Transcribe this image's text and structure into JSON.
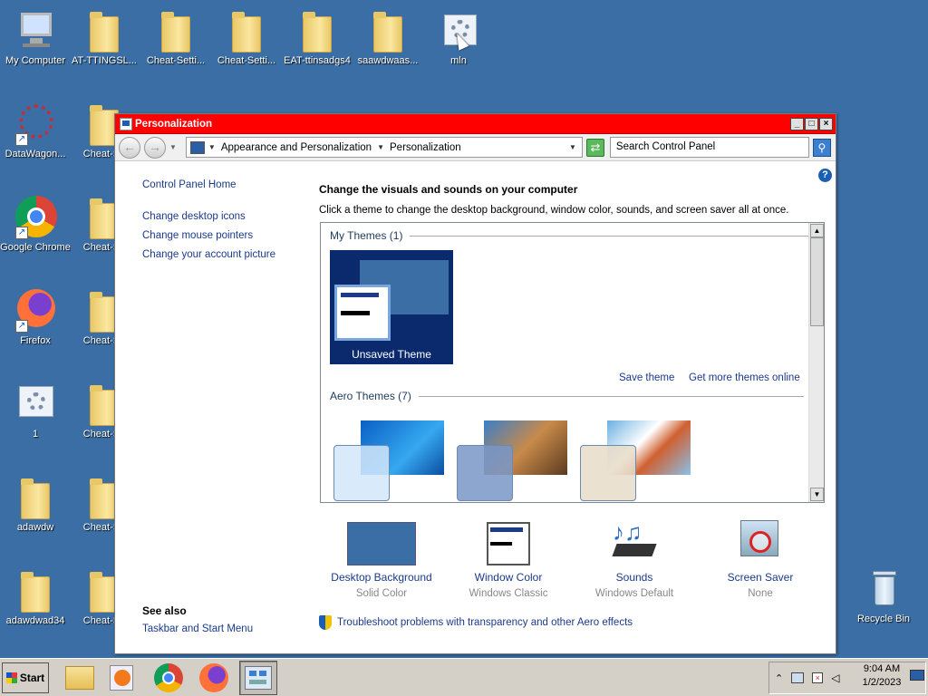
{
  "desktop": {
    "icons": [
      {
        "label": "My Computer",
        "icon": "computer-icon"
      },
      {
        "label": "AT-TTINGSL...",
        "icon": "folder-icon"
      },
      {
        "label": "Cheat-Setti...",
        "icon": "folder-icon"
      },
      {
        "label": "Cheat-Setti...",
        "icon": "folder-icon"
      },
      {
        "label": "EAT-ttinsadgs4",
        "icon": "folder-icon"
      },
      {
        "label": "saawdwaas...",
        "icon": "folder-icon"
      },
      {
        "label": "mln",
        "icon": "settings-icon"
      },
      {
        "label": "DataWagon...",
        "icon": "datawagon-icon"
      },
      {
        "label": "Cheat-Se",
        "icon": "folder-icon"
      },
      {
        "label": "Google Chrome",
        "icon": "chrome-icon"
      },
      {
        "label": "Cheat-Se",
        "icon": "folder-icon"
      },
      {
        "label": "Firefox",
        "icon": "firefox-icon"
      },
      {
        "label": "Cheat-Se",
        "icon": "folder-icon"
      },
      {
        "label": "1",
        "icon": "settings-icon"
      },
      {
        "label": "Cheat-Se",
        "icon": "folder-icon"
      },
      {
        "label": "adawdw",
        "icon": "folder-icon"
      },
      {
        "label": "Cheat-Se",
        "icon": "folder-icon"
      },
      {
        "label": "adawdwad34",
        "icon": "folder-icon"
      },
      {
        "label": "Cheat-Se",
        "icon": "folder-icon"
      },
      {
        "label": "Recycle Bin",
        "icon": "recycle-bin-icon"
      }
    ]
  },
  "window": {
    "title": "Personalization",
    "breadcrumb": [
      "Appearance and Personalization",
      "Personalization"
    ],
    "search_placeholder": "Search Control Panel",
    "title_color": "#ff0000"
  },
  "left_pane": {
    "home": "Control Panel Home",
    "links": [
      "Change desktop icons",
      "Change mouse pointers",
      "Change your account picture"
    ],
    "see_also_heading": "See also",
    "see_also_links": [
      "Taskbar and Start Menu"
    ]
  },
  "main": {
    "heading": "Change the visuals and sounds on your computer",
    "description": "Click a theme to change the desktop background, window color, sounds, and screen saver all at once.",
    "my_themes_label": "My Themes (1)",
    "unsaved_theme_label": "Unsaved Theme",
    "save_theme": "Save theme",
    "get_more_themes": "Get more themes online",
    "aero_themes_label": "Aero Themes (7)",
    "bottom_items": [
      {
        "title": "Desktop Background",
        "subtitle": "Solid Color",
        "icon": "desktop-background-icon"
      },
      {
        "title": "Window Color",
        "subtitle": "Windows Classic",
        "icon": "window-color-icon"
      },
      {
        "title": "Sounds",
        "subtitle": "Windows Default",
        "icon": "sounds-icon"
      },
      {
        "title": "Screen Saver",
        "subtitle": "None",
        "icon": "screen-saver-icon"
      }
    ],
    "troubleshoot": "Troubleshoot problems with transparency and other Aero effects"
  },
  "taskbar": {
    "start_label": "Start",
    "time": "9:04 AM",
    "date": "1/2/2023"
  }
}
